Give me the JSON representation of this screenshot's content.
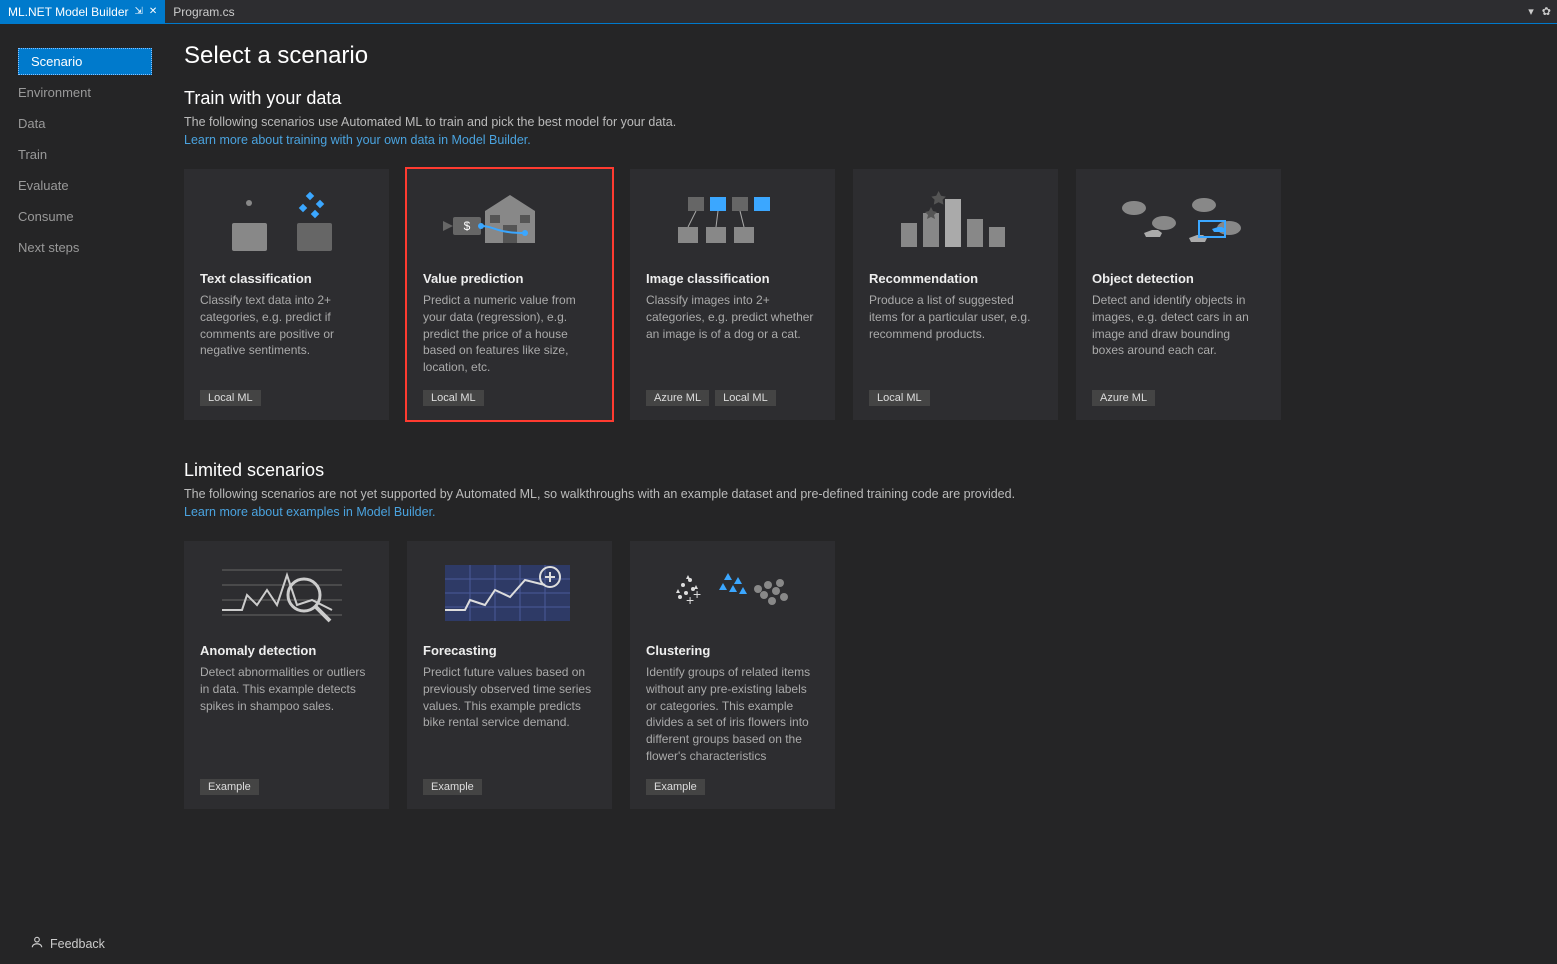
{
  "tabs": {
    "active": "ML.NET Model Builder",
    "inactive": "Program.cs"
  },
  "sidebar": {
    "items": [
      "Scenario",
      "Environment",
      "Data",
      "Train",
      "Evaluate",
      "Consume",
      "Next steps"
    ],
    "selectedIndex": 0
  },
  "page": {
    "title": "Select a scenario",
    "section1": {
      "heading": "Train with your data",
      "sub": "The following scenarios use Automated ML to train and pick the best model for your data.",
      "link": "Learn more about training with your own data in Model Builder."
    },
    "section2": {
      "heading": "Limited scenarios",
      "sub": "The following scenarios are not yet supported by Automated ML, so walkthroughs with an example dataset and pre-defined training code are provided.",
      "link": "Learn more about examples in Model Builder."
    }
  },
  "cards1": [
    {
      "title": "Text classification",
      "desc": "Classify text data into 2+ categories, e.g. predict if comments are positive or negative sentiments.",
      "badges": [
        "Local ML"
      ],
      "highlight": false
    },
    {
      "title": "Value prediction",
      "desc": "Predict a numeric value from your data (regression), e.g. predict the price of a house based on features like size, location, etc.",
      "badges": [
        "Local ML"
      ],
      "highlight": true
    },
    {
      "title": "Image classification",
      "desc": "Classify images into 2+ categories, e.g. predict whether an image is of a dog or a cat.",
      "badges": [
        "Azure ML",
        "Local ML"
      ],
      "highlight": false
    },
    {
      "title": "Recommendation",
      "desc": "Produce a list of suggested items for a particular user, e.g. recommend products.",
      "badges": [
        "Local ML"
      ],
      "highlight": false
    },
    {
      "title": "Object detection",
      "desc": "Detect and identify objects in images, e.g. detect cars in an image and draw bounding boxes around each car.",
      "badges": [
        "Azure ML"
      ],
      "highlight": false
    }
  ],
  "cards2": [
    {
      "title": "Anomaly detection",
      "desc": "Detect abnormalities or outliers in data. This example detects spikes in shampoo sales.",
      "badges": [
        "Example"
      ]
    },
    {
      "title": "Forecasting",
      "desc": "Predict future values based on previously observed time series values. This example predicts bike rental service demand.",
      "badges": [
        "Example"
      ]
    },
    {
      "title": "Clustering",
      "desc": "Identify groups of related items without any pre-existing labels or categories. This example divides a set of iris flowers into different groups based on the flower's characteristics",
      "badges": [
        "Example"
      ]
    }
  ],
  "feedback": "Feedback"
}
